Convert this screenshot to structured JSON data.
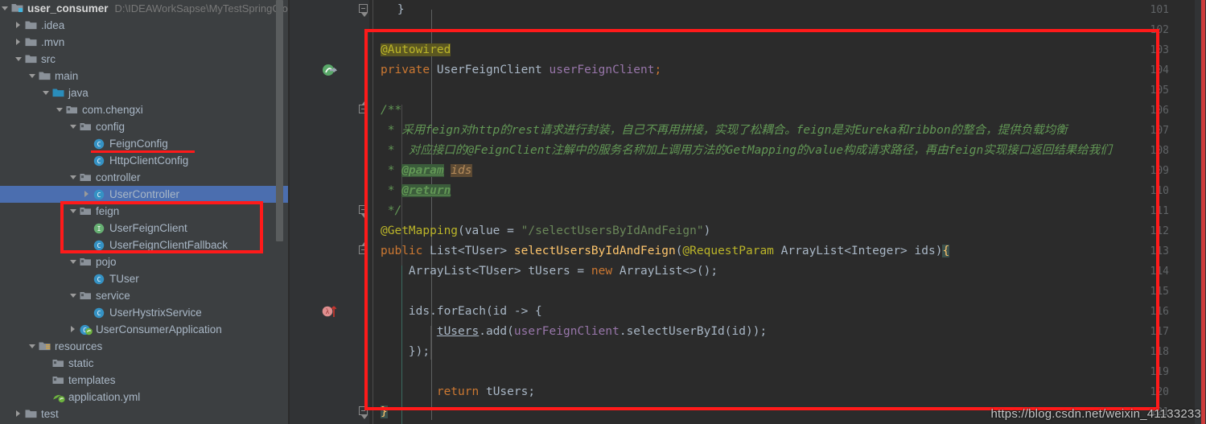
{
  "window": {
    "project_name": "user_consumer",
    "project_path": "D:\\IDEAWorkSapse\\MyTestSpringCloud",
    "watermark": "https://blog.csdn.net/weixin_41133233"
  },
  "theme": {
    "sidebar_bg": "#3c3f41",
    "editor_bg": "#2b2b2b",
    "gutter_bg": "#313335",
    "selection_blue": "#4b6eaf",
    "annotation_red": "#ff1a1a",
    "keyword_orange": "#cc7832",
    "annotation_yellow": "#bbb529",
    "string_green": "#6a8759",
    "comment_green": "#629755",
    "field_purple": "#9876aa",
    "method_yellow": "#ffc66d",
    "text_gray": "#a9b7c6"
  },
  "sidebar": {
    "items": [
      {
        "label": "user_consumer",
        "indent": 0,
        "arrow": "down",
        "icon": "module-icon",
        "bold": true,
        "selected": false,
        "path": "D:\\IDEAWorkSapse\\MyTestSpringCloud"
      },
      {
        "label": ".idea",
        "indent": 1,
        "arrow": "right",
        "icon": "folder-icon",
        "bold": false,
        "selected": false
      },
      {
        "label": ".mvn",
        "indent": 1,
        "arrow": "right",
        "icon": "folder-icon",
        "bold": false,
        "selected": false
      },
      {
        "label": "src",
        "indent": 1,
        "arrow": "down",
        "icon": "folder-icon",
        "bold": false,
        "selected": false
      },
      {
        "label": "main",
        "indent": 2,
        "arrow": "down",
        "icon": "folder-icon",
        "bold": false,
        "selected": false
      },
      {
        "label": "java",
        "indent": 3,
        "arrow": "down",
        "icon": "source-root-icon",
        "bold": false,
        "selected": false
      },
      {
        "label": "com.chengxi",
        "indent": 4,
        "arrow": "down",
        "icon": "package-icon",
        "bold": false,
        "selected": false
      },
      {
        "label": "config",
        "indent": 5,
        "arrow": "down",
        "icon": "package-icon",
        "bold": false,
        "selected": false
      },
      {
        "label": "FeignConfig",
        "indent": 6,
        "arrow": "none",
        "icon": "class-icon",
        "bold": false,
        "selected": false
      },
      {
        "label": "HttpClientConfig",
        "indent": 6,
        "arrow": "none",
        "icon": "class-icon",
        "bold": false,
        "selected": false
      },
      {
        "label": "controller",
        "indent": 5,
        "arrow": "down",
        "icon": "package-icon",
        "bold": false,
        "selected": false
      },
      {
        "label": "UserController",
        "indent": 6,
        "arrow": "right",
        "icon": "class-icon",
        "bold": false,
        "selected": true
      },
      {
        "label": "feign",
        "indent": 5,
        "arrow": "down",
        "icon": "package-icon",
        "bold": false,
        "selected": false
      },
      {
        "label": "UserFeignClient",
        "indent": 6,
        "arrow": "none",
        "icon": "interface-icon",
        "bold": false,
        "selected": false
      },
      {
        "label": "UserFeignClientFallback",
        "indent": 6,
        "arrow": "none",
        "icon": "class-icon",
        "bold": false,
        "selected": false
      },
      {
        "label": "pojo",
        "indent": 5,
        "arrow": "down",
        "icon": "package-icon",
        "bold": false,
        "selected": false
      },
      {
        "label": "TUser",
        "indent": 6,
        "arrow": "none",
        "icon": "class-icon",
        "bold": false,
        "selected": false
      },
      {
        "label": "service",
        "indent": 5,
        "arrow": "down",
        "icon": "package-icon",
        "bold": false,
        "selected": false
      },
      {
        "label": "UserHystrixService",
        "indent": 6,
        "arrow": "none",
        "icon": "class-icon",
        "bold": false,
        "selected": false
      },
      {
        "label": "UserConsumerApplication",
        "indent": 5,
        "arrow": "right",
        "icon": "spring-class-icon",
        "bold": false,
        "selected": false
      },
      {
        "label": "resources",
        "indent": 2,
        "arrow": "down",
        "icon": "resource-root-icon",
        "bold": false,
        "selected": false
      },
      {
        "label": "static",
        "indent": 3,
        "arrow": "none",
        "icon": "package-icon",
        "bold": false,
        "selected": false
      },
      {
        "label": "templates",
        "indent": 3,
        "arrow": "none",
        "icon": "package-icon",
        "bold": false,
        "selected": false
      },
      {
        "label": "application.yml",
        "indent": 3,
        "arrow": "none",
        "icon": "spring-yaml-icon",
        "bold": false,
        "selected": false
      },
      {
        "label": "test",
        "indent": 1,
        "arrow": "right",
        "icon": "folder-icon",
        "bold": false,
        "selected": false
      }
    ]
  },
  "editor": {
    "lines": [
      {
        "num": "101",
        "gutter_icon": "none",
        "fold": "end"
      },
      {
        "num": "102",
        "gutter_icon": "none",
        "fold": "none"
      },
      {
        "num": "103",
        "gutter_icon": "none",
        "fold": "none"
      },
      {
        "num": "104",
        "gutter_icon": "implemented-icon",
        "fold": "none"
      },
      {
        "num": "105",
        "gutter_icon": "none",
        "fold": "none"
      },
      {
        "num": "106",
        "gutter_icon": "none",
        "fold": "start"
      },
      {
        "num": "107",
        "gutter_icon": "none",
        "fold": "none"
      },
      {
        "num": "108",
        "gutter_icon": "none",
        "fold": "none"
      },
      {
        "num": "109",
        "gutter_icon": "none",
        "fold": "none"
      },
      {
        "num": "110",
        "gutter_icon": "none",
        "fold": "none"
      },
      {
        "num": "111",
        "gutter_icon": "none",
        "fold": "end"
      },
      {
        "num": "112",
        "gutter_icon": "none",
        "fold": "none"
      },
      {
        "num": "113",
        "gutter_icon": "none",
        "fold": "start"
      },
      {
        "num": "114",
        "gutter_icon": "none",
        "fold": "none"
      },
      {
        "num": "115",
        "gutter_icon": "none",
        "fold": "none"
      },
      {
        "num": "116",
        "gutter_icon": "lambda-icon",
        "fold": "none"
      },
      {
        "num": "117",
        "gutter_icon": "none",
        "fold": "none"
      },
      {
        "num": "118",
        "gutter_icon": "none",
        "fold": "none"
      },
      {
        "num": "119",
        "gutter_icon": "none",
        "fold": "none"
      },
      {
        "num": "120",
        "gutter_icon": "none",
        "fold": "none"
      },
      {
        "num": "121",
        "gutter_icon": "none",
        "fold": "end"
      }
    ],
    "code": {
      "l101": "    }",
      "l103_anno": "@Autowired",
      "l104_kw": "private",
      "l104_type": " UserFeignClient ",
      "l104_var": "userFeignClient",
      "l104_end": ";",
      "l106": "/**",
      "l107": " * 采用feign对http的rest请求进行封装，自己不再用拼接，实现了松耦合。feign是对Eureka和ribbon的整合，提供负载均衡",
      "l108": " *  对应接口的@FeignClient注解中的服务名称加上调用方法的GetMapping的value构成请求路径，再由feign实现接口返回结果给我们",
      "l109_star": " * ",
      "l109_tag": "@param",
      "l109_val": "ids",
      "l110_star": " * ",
      "l110_tag": "@return",
      "l111": " */",
      "l112_anno": "@GetMapping",
      "l112_mid": "(value = ",
      "l112_str": "\"/selectUsersByIdAndFeign\"",
      "l112_end": ")",
      "l113_kw": "public",
      "l113_type": " List<TUser> ",
      "l113_mth": "selectUsersByIdAndFeign",
      "l113_open": "(",
      "l113_anno": "@RequestParam",
      "l113_param": " ArrayList<Integer> ids)",
      "l113_brace": "{",
      "l114": "    ArrayList<TUser> tUsers = ",
      "l114_kw": "new",
      "l114_end": " ArrayList<>();",
      "l116": "    ids.forEach(id -> {",
      "l117_ind": "        ",
      "l117_var": "tUsers",
      "l117_mid": ".add(",
      "l117_fld": "userFeignClient",
      "l117_end": ".selectUserById(id));",
      "l118": "    });",
      "l120_ind": "        ",
      "l120_kw": "return",
      "l120_end": " tUsers;",
      "l121_brace": "}"
    }
  },
  "annotations": {
    "underline_feignconfig": "red-underline",
    "box_feign_package": "red-box",
    "box_code_block": "red-box"
  }
}
